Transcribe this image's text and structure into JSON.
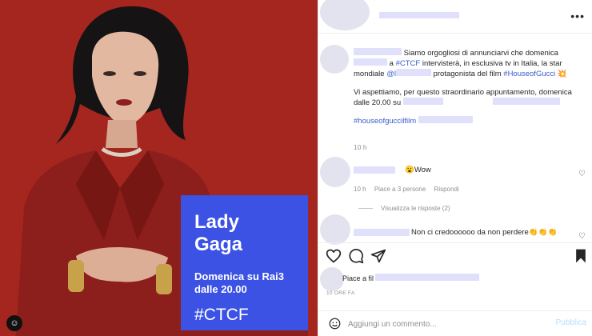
{
  "promo": {
    "name_line1": "Lady",
    "name_line2": "Gaga",
    "when_line1": "Domenica su Rai3",
    "when_line2": "dalle 20.00",
    "hashtag": "#CTCF"
  },
  "media_badge": "☺",
  "header": {
    "more_label": "•••"
  },
  "caption": {
    "p1": {
      "t1": "Siamo orgogliosi di annunciarvi che domenica",
      "t2": "a",
      "tag1": "#CTCF",
      "t3": "intervisterà, in esclusiva tv in Italia, la star mondiale",
      "tag2": "@l",
      "t4": "protagonista del film",
      "tag3": "#HouseofGucci",
      "emoji": "💥"
    },
    "p2": {
      "t1": "Vi aspettiamo, per questo straordinario appuntamento, domenica dalle 20.00 su"
    },
    "p3": {
      "tag": "#houseofguccilfilm"
    },
    "time": "10 h"
  },
  "comments": [
    {
      "text": "😮Wow",
      "time": "10 h",
      "likes": "Piace a 3 persone",
      "reply": "Rispondi"
    },
    {
      "text": "Non ci credoooooo da non perdere👏👏👏"
    }
  ],
  "replies_label": "Visualizza le risposte (2)",
  "likes_prefix": "Piace a fil",
  "posted": "10 ORE FA",
  "add_comment": {
    "placeholder": "Aggiungi un commento...",
    "publish": "Pubblica"
  },
  "colors": {
    "accent": "#3b52e4",
    "link": "#3b5bcc",
    "publish_disabled": "#b2dffc"
  }
}
